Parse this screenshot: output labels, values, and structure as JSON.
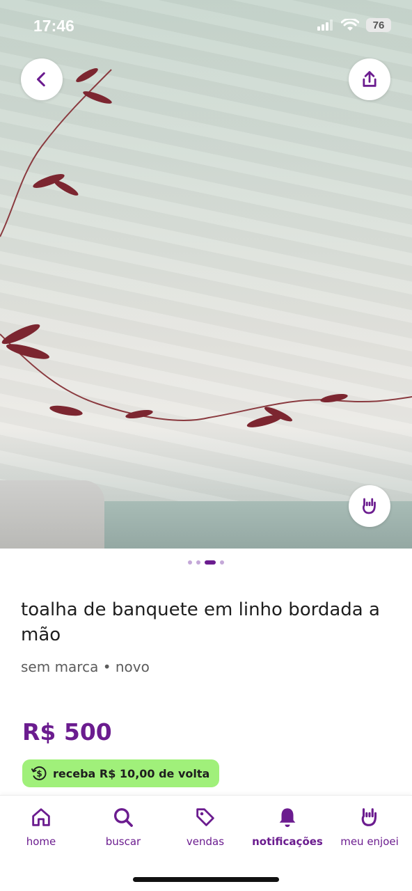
{
  "status_bar": {
    "time": "17:46",
    "battery": "76"
  },
  "gallery": {
    "image_count": 4,
    "active_index": 2
  },
  "product": {
    "title": "toalha de banquete em linho bordada a mão",
    "subtitle": "sem marca • novo",
    "price": "R$ 500",
    "cashback": "receba R$ 10,00 de volta"
  },
  "icons": {
    "back": "chevron-left-icon",
    "share": "share-icon",
    "enjoei": "rock-hand-icon",
    "cashback": "dollar-circle-icon"
  },
  "nav": {
    "items": [
      {
        "label": "home",
        "icon": "home-icon"
      },
      {
        "label": "buscar",
        "icon": "search-icon"
      },
      {
        "label": "vendas",
        "icon": "tag-icon"
      },
      {
        "label": "notificações",
        "icon": "bell-icon",
        "active": true
      },
      {
        "label": "meu enjoei",
        "icon": "rock-hand-icon"
      }
    ]
  },
  "colors": {
    "brand": "#6b1c8f",
    "cashback_bg": "#a0f07a",
    "dot_inactive": "#c4a8d8"
  }
}
